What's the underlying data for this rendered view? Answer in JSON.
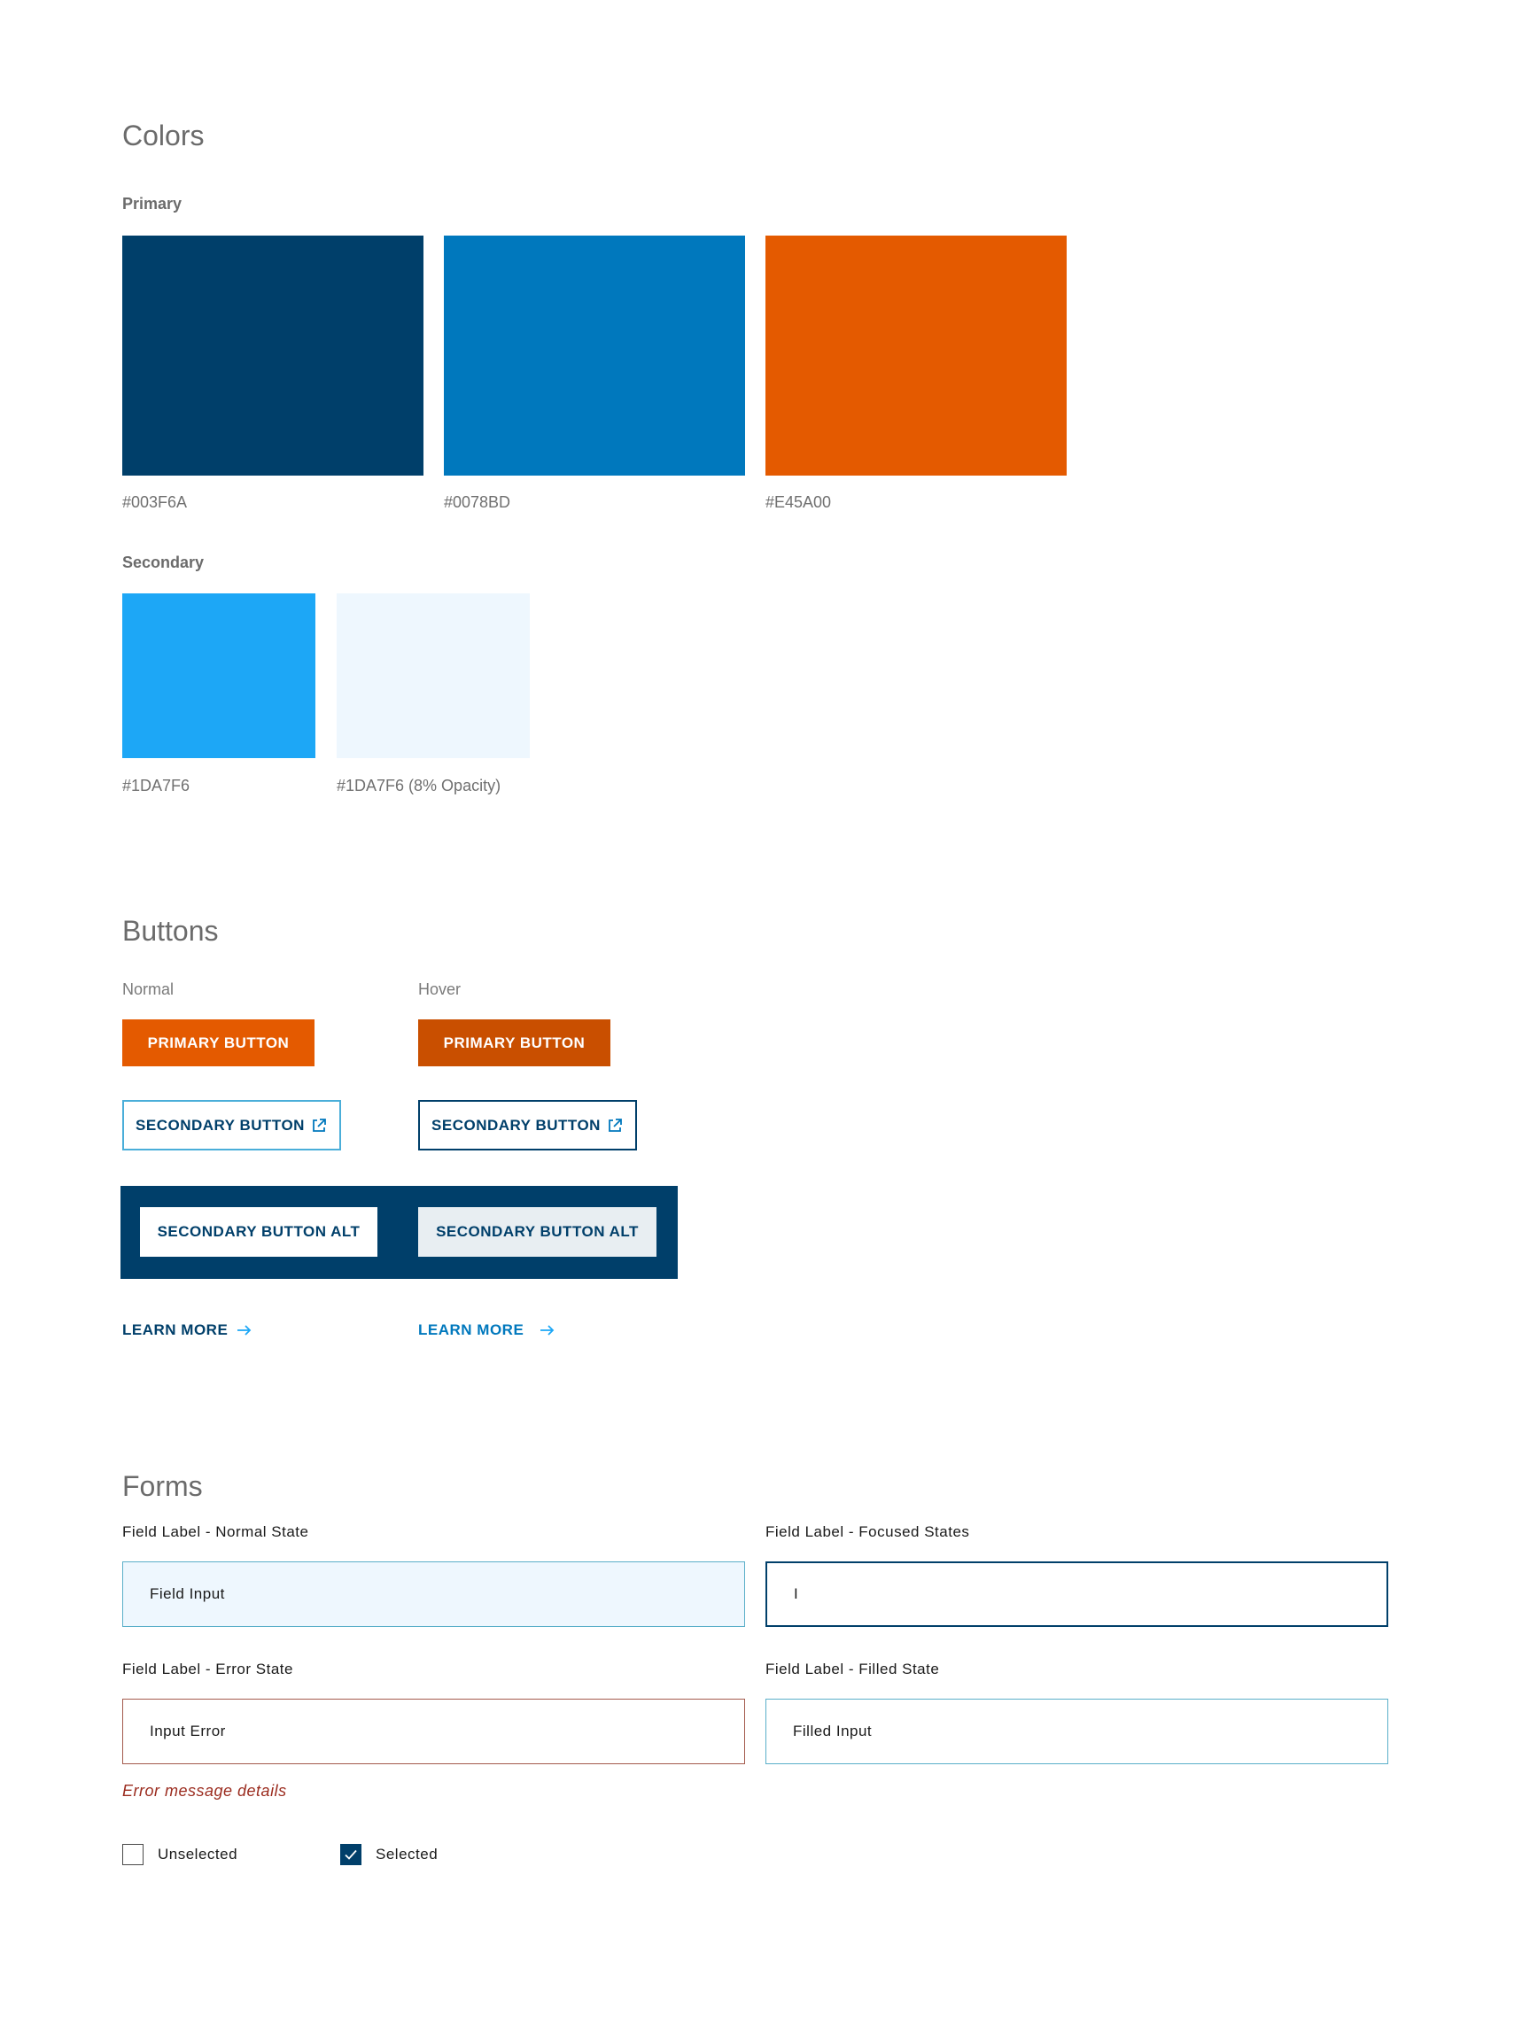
{
  "colors": {
    "title": "Colors",
    "primary_label": "Primary",
    "primary": [
      {
        "hex_label": "#003F6A",
        "color": "#003F6A"
      },
      {
        "hex_label": "#0078BD",
        "color": "#0078BD"
      },
      {
        "hex_label": "#E45A00",
        "color": "#E45A00"
      }
    ],
    "secondary_label": "Secondary",
    "secondary": [
      {
        "hex_label": "#1DA7F6",
        "color": "#1DA7F6"
      },
      {
        "hex_label": "#1DA7F6 (8% Opacity)",
        "color": "#EEF7FE"
      }
    ]
  },
  "buttons": {
    "title": "Buttons",
    "normal_label": "Normal",
    "hover_label": "Hover",
    "primary_label": "PRIMARY BUTTON",
    "secondary_label": "SECONDARY BUTTON",
    "secondary_alt_label": "SECONDARY BUTTON ALT",
    "learn_more_label": "LEARN MORE",
    "colors": {
      "primary_normal": "#E45A00",
      "primary_hover": "#C94F00",
      "navy": "#003F6A",
      "alt_hover_bg": "#E8EEF2",
      "link_hover": "#0078BD"
    }
  },
  "forms": {
    "title": "Forms",
    "normal": {
      "label": "Field Label - Normal State",
      "value": "Field Input"
    },
    "focused": {
      "label": "Field Label - Focused States",
      "value": "I"
    },
    "error": {
      "label": "Field Label - Error State",
      "value": "Input Error",
      "message": "Error message details"
    },
    "filled": {
      "label": "Field Label - Filled State",
      "value": "Filled Input"
    },
    "unselected_label": "Unselected",
    "selected_label": "Selected"
  }
}
